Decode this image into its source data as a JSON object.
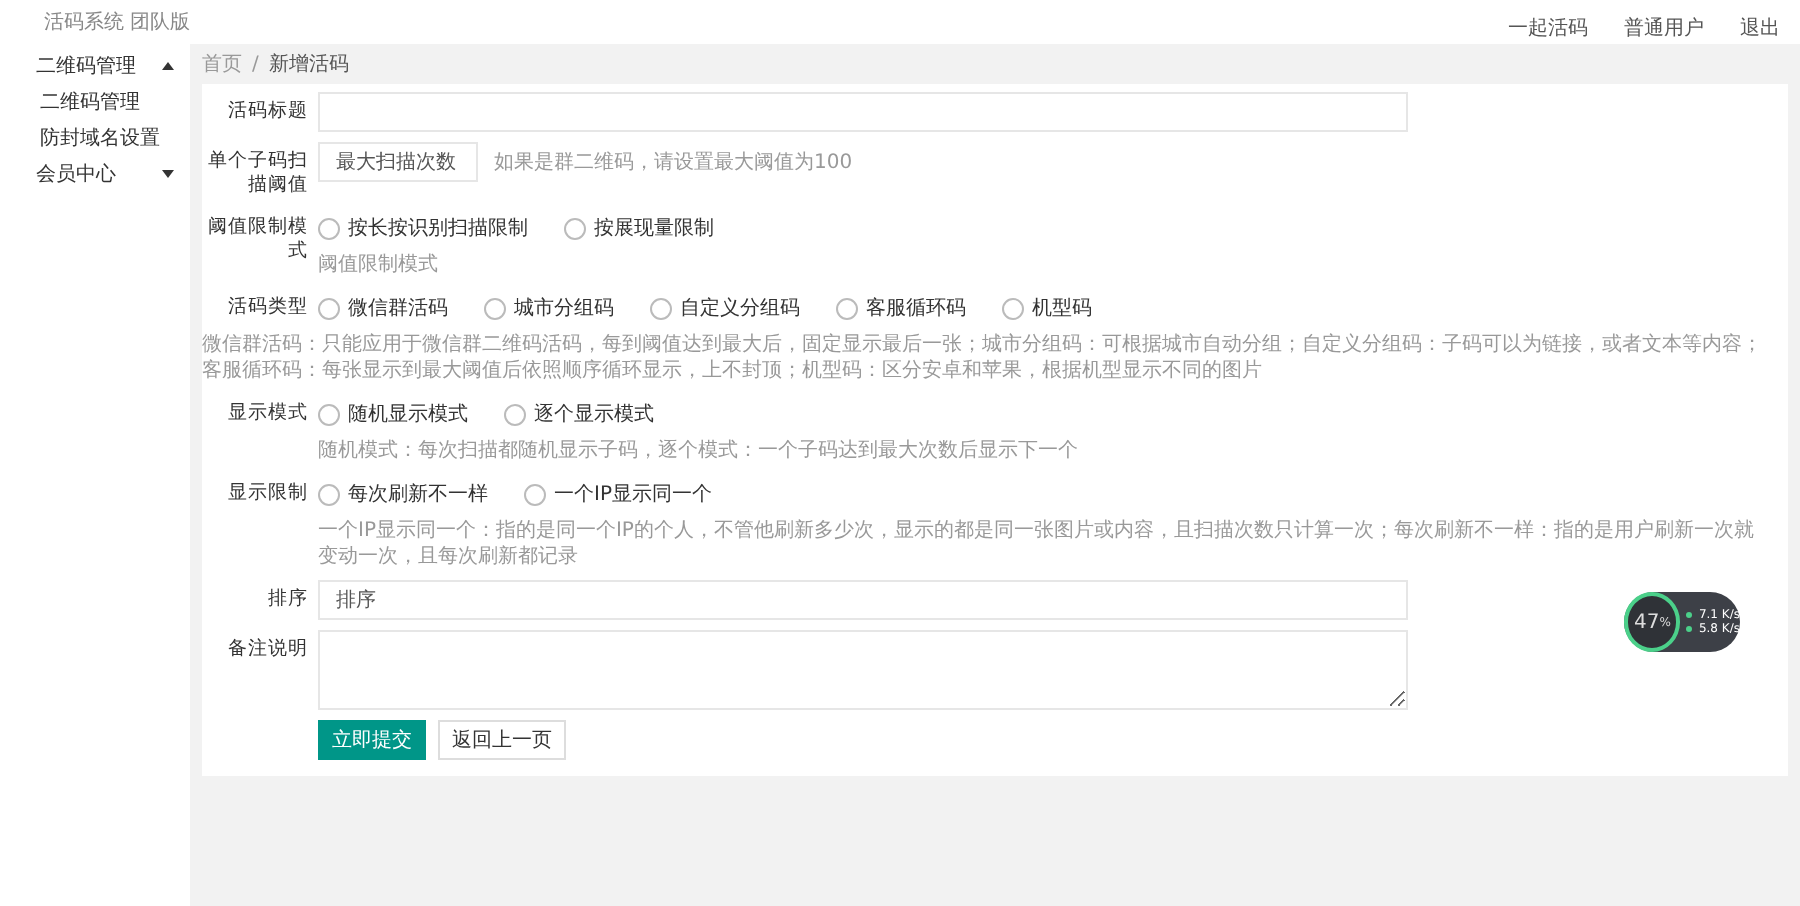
{
  "header": {
    "brand": "活码系统 团队版",
    "links": [
      "一起活码",
      "普通用户",
      "退出"
    ]
  },
  "sidebar": {
    "items": [
      {
        "label": "二维码管理",
        "expanded": true,
        "children": [
          {
            "label": "二维码管理"
          },
          {
            "label": "防封域名设置"
          }
        ]
      },
      {
        "label": "会员中心",
        "expanded": false
      }
    ]
  },
  "breadcrumb": {
    "items": [
      "首页",
      "新增活码"
    ],
    "separator": "/"
  },
  "form": {
    "fields": [
      {
        "kind": "input",
        "label": "活码标题"
      },
      {
        "kind": "input",
        "label": "单个子码扫描阈值",
        "placeholder": "最大扫描次数",
        "hint": "如果是群二维码，请设置最大阈值为100",
        "short": true
      },
      {
        "kind": "radio",
        "label": "阈值限制模式",
        "options": [
          {
            "label": "按长按识别扫描限制",
            "selected": false
          },
          {
            "label": "按展现量限制",
            "selected": false
          }
        ],
        "help": "阈值限制模式"
      },
      {
        "kind": "radio",
        "label": "活码类型",
        "options": [
          {
            "label": "微信群活码",
            "selected": false
          },
          {
            "label": "城市分组码",
            "selected": false
          },
          {
            "label": "自定义分组码",
            "selected": false
          },
          {
            "label": "客服循环码",
            "selected": false
          },
          {
            "label": "机型码",
            "selected": false
          }
        ],
        "help": "微信群活码：只能应用于微信群二维码活码，每到阈值达到最大后，固定显示最后一张；城市分组码：可根据城市自动分组；自定义分组码：子码可以为链接，或者文本等内容；客服循环码：每张显示到最大阈值后依照顺序循环显示，上不封顶；机型码：区分安卓和苹果，根据机型显示不同的图片",
        "wide": true
      },
      {
        "kind": "radio",
        "label": "显示模式",
        "options": [
          {
            "label": "随机显示模式",
            "selected": false
          },
          {
            "label": "逐个显示模式",
            "selected": false
          }
        ],
        "help": "随机模式：每次扫描都随机显示子码，逐个模式：一个子码达到最大次数后显示下一个"
      },
      {
        "kind": "radio",
        "label": "显示限制",
        "options": [
          {
            "label": "每次刷新不一样",
            "selected": false
          },
          {
            "label": "一个IP显示同一个",
            "selected": false
          }
        ],
        "help": "一个IP显示同一个：指的是同一个IP的个人，不管他刷新多少次，显示的都是同一张图片或内容，且扫描次数只计算一次；每次刷新不一样：指的是用户刷新一次就变动一次，且每次刷新都记录"
      },
      {
        "kind": "input",
        "label": "排序",
        "placeholder": "排序"
      },
      {
        "kind": "textarea",
        "label": "备注说明"
      }
    ],
    "buttons": [
      {
        "label": "立即提交",
        "primary": true
      },
      {
        "label": "返回上一页",
        "primary": false
      }
    ]
  },
  "speed_widget": {
    "percent": "47",
    "unit": "%",
    "up": "7.1",
    "up_unit": "K/s",
    "down": "5.8",
    "down_unit": "K/s"
  }
}
